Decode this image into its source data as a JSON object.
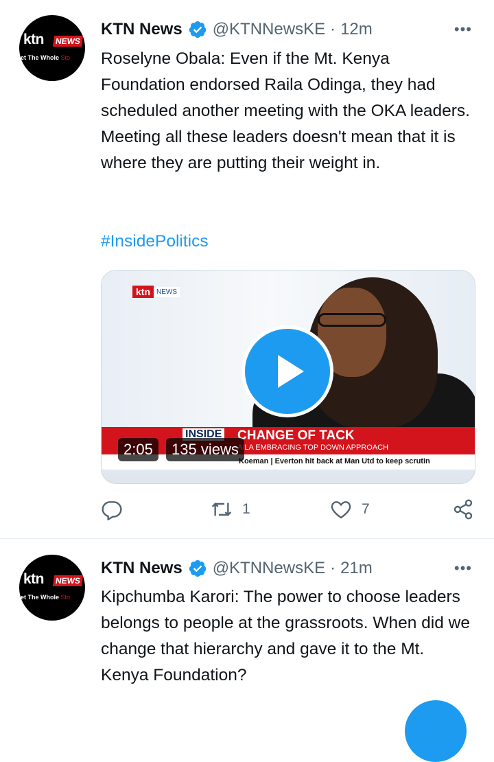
{
  "tweets": [
    {
      "author": "KTN News",
      "handle": "@KTNNewsKE",
      "separator": "·",
      "time": "12m",
      "more": "•••",
      "avatar": {
        "logo": "ktn",
        "badge": "NEWS",
        "slogan_a": "et The Whole ",
        "slogan_b": "Sto"
      },
      "text": "Roselyne Obala: Even if the Mt. Kenya Foundation endorsed Raila Odinga, they had scheduled another meeting with the OKA leaders. Meeting all these leaders doesn't mean that it is where they are putting their weight in.",
      "hashtag": "#InsidePolitics",
      "video": {
        "logo": "ktn",
        "logo_badge": "NEWS",
        "show_label": "INSIDE",
        "headline": "CHANGE OF TACK",
        "subheadline": "AILA EMBRACING TOP DOWN APPROACH",
        "ticker": "Koeman | Everton hit back at Man Utd to keep scrutin",
        "duration": "2:05",
        "views": "135 views"
      },
      "actions": {
        "reply": "",
        "retweets": "1",
        "likes": "7",
        "share": ""
      }
    },
    {
      "author": "KTN News",
      "handle": "@KTNNewsKE",
      "separator": "·",
      "time": "21m",
      "more": "•••",
      "avatar": {
        "logo": "ktn",
        "badge": "NEWS",
        "slogan_a": "et The Whole ",
        "slogan_b": "Sto"
      },
      "text": "Kipchumba Karori: The power to choose leaders belongs to people at the grassroots. When did we change that hierarchy and gave it to the Mt. Kenya Foundation?"
    }
  ],
  "colors": {
    "accent": "#1d9bf0",
    "muted": "#536471",
    "ktn_red": "#d4141c"
  }
}
